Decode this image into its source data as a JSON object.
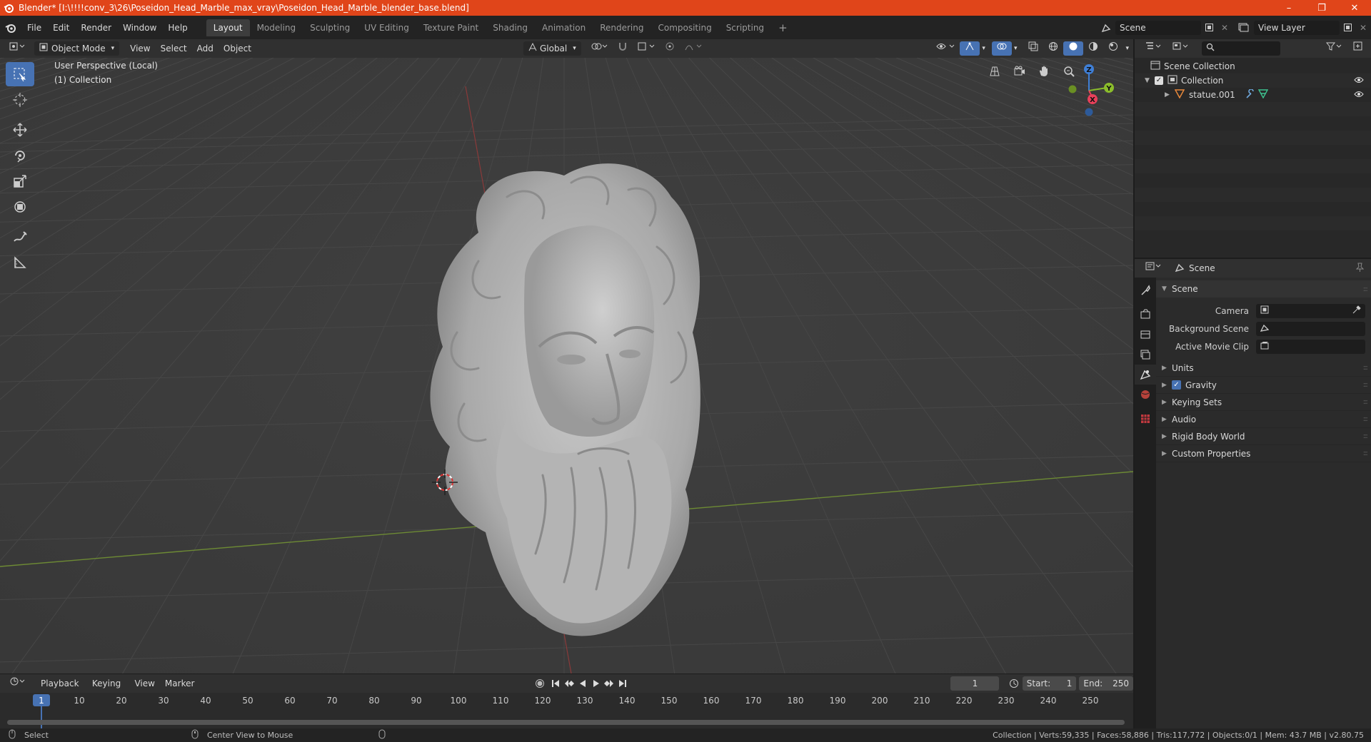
{
  "window": {
    "title": "Blender* [I:\\!!!!conv_3\\26\\Poseidon_Head_Marble_max_vray\\Poseidon_Head_Marble_blender_base.blend]",
    "minimize": "–",
    "maximize": "❐",
    "close": "✕"
  },
  "menu": {
    "items": [
      "File",
      "Edit",
      "Render",
      "Window",
      "Help"
    ]
  },
  "workspaces": {
    "tabs": [
      "Layout",
      "Modeling",
      "Sculpting",
      "UV Editing",
      "Texture Paint",
      "Shading",
      "Animation",
      "Rendering",
      "Compositing",
      "Scripting"
    ],
    "add": "+"
  },
  "topright": {
    "scene": "Scene",
    "view_layer": "View Layer"
  },
  "viewport_header": {
    "mode": "Object Mode",
    "menus": [
      "View",
      "Select",
      "Add",
      "Object"
    ],
    "orientation": "Global"
  },
  "viewport": {
    "perspective": "User Perspective (Local)",
    "collection": "(1) Collection",
    "gizmo": {
      "x": "X",
      "y": "Y",
      "z": "Z"
    }
  },
  "outliner": {
    "root": "Scene Collection",
    "collection": "Collection",
    "object": "statue.001"
  },
  "properties": {
    "header": "Scene",
    "panel": "Scene",
    "camera_label": "Camera",
    "background_scene_label": "Background Scene",
    "active_movie_clip_label": "Active Movie Clip",
    "subpanels": [
      "Units",
      "Gravity",
      "Keying Sets",
      "Audio",
      "Rigid Body World",
      "Custom Properties"
    ]
  },
  "timeline": {
    "menus": [
      "Playback",
      "Keying",
      "View",
      "Marker"
    ],
    "current_frame": "1",
    "start_label": "Start:",
    "start": "1",
    "end_label": "End:",
    "end": "250",
    "ruler": [
      "1",
      "10",
      "20",
      "30",
      "40",
      "50",
      "60",
      "70",
      "80",
      "90",
      "100",
      "110",
      "120",
      "130",
      "140",
      "150",
      "160",
      "170",
      "180",
      "190",
      "200",
      "210",
      "220",
      "230",
      "240",
      "250"
    ]
  },
  "statusbar": {
    "left1": "Select",
    "left2": "Center View to Mouse",
    "right": "Collection | Verts:59,335 | Faces:58,886 | Tris:117,772 | Objects:0/1 | Mem: 43.7 MB | v2.80.75"
  },
  "colors": {
    "title_bar": "#e0451a",
    "accent": "#4772b3",
    "x_axis": "#e8405a",
    "y_axis": "#8bbd2b",
    "z_axis": "#3f7fd6"
  }
}
